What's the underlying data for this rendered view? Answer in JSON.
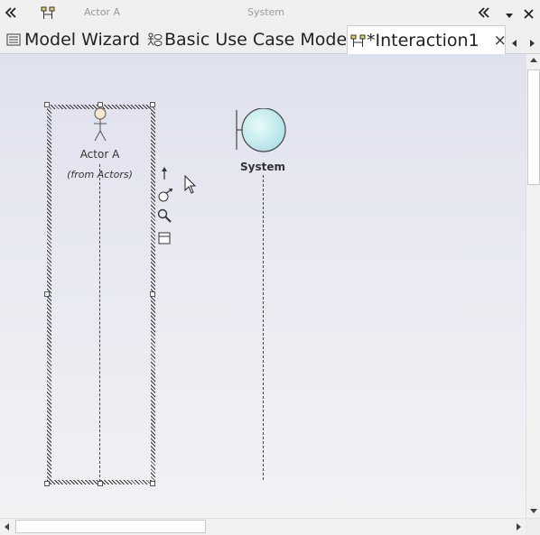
{
  "topbar": {
    "collapse_icon": "double-chevron-left",
    "diagram_icon": "sequence-diagram-icon",
    "crumb_actor": "Actor A",
    "crumb_system": "System",
    "expand_icon": "double-chevron-left",
    "menu_icon": "chevron-down",
    "close_icon": "close"
  },
  "tabs": [
    {
      "label": "Model Wizard",
      "icon": "model-wizard-icon",
      "active": false
    },
    {
      "label": "Basic Use Case Model",
      "icon": "use-case-model-icon",
      "active": false
    },
    {
      "label": "*Interaction1",
      "icon": "sequence-diagram-icon",
      "active": true
    }
  ],
  "tab_close_symbol": "×",
  "diagram": {
    "actor_name": "Actor A",
    "actor_package": "(from Actors)",
    "system_name": "System"
  },
  "quick_tools": [
    "link-arrow-icon",
    "lifeline-tool-icon",
    "zoom-icon",
    "properties-icon"
  ],
  "colors": {
    "canvas_top": "#dfe1ee",
    "canvas_bottom": "#f2f2f5",
    "boundary_fill": "#c9eef0",
    "actor_head": "#f7e9c9"
  }
}
